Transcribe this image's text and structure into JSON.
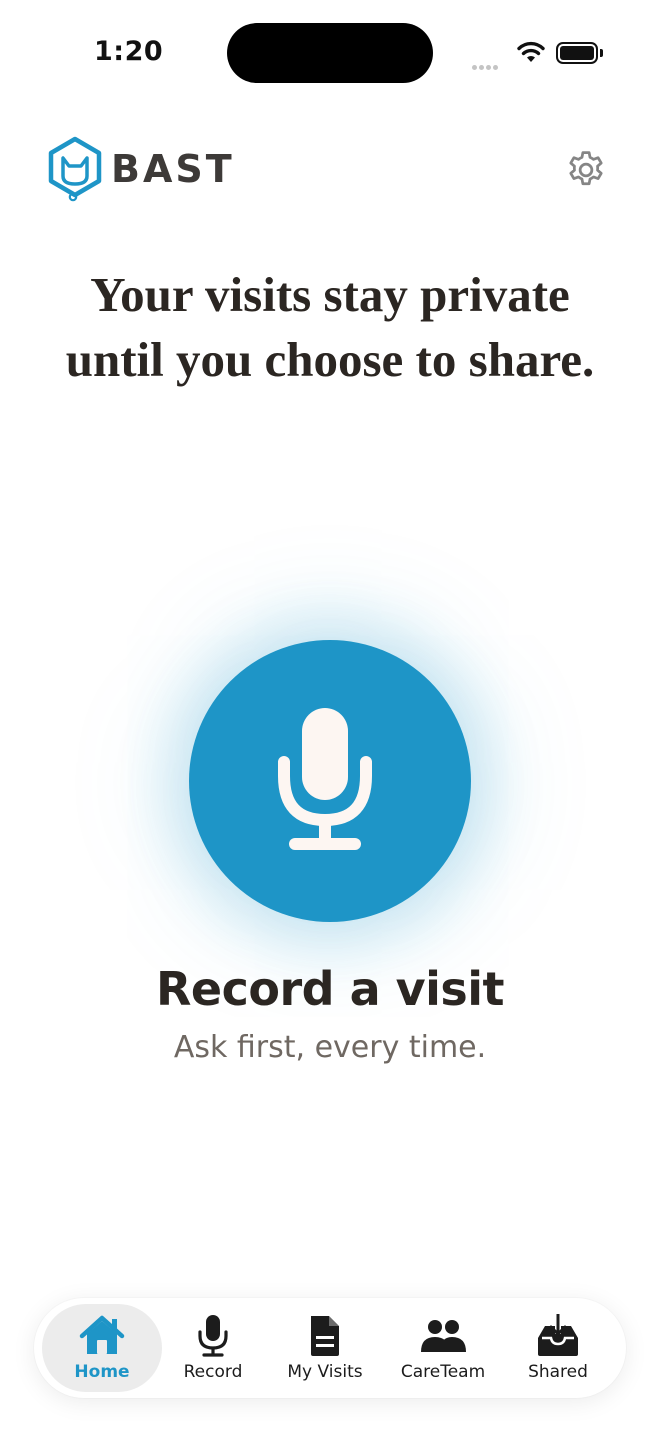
{
  "status_bar": {
    "time": "1:20"
  },
  "header": {
    "brand": "BAST"
  },
  "headline": "Your visits stay private until you choose to share.",
  "record": {
    "title": "Record a visit",
    "subtitle": "Ask first, every time."
  },
  "tabs": [
    {
      "label": "Home",
      "icon": "home-icon",
      "active": true
    },
    {
      "label": "Record",
      "icon": "microphone-icon",
      "active": false
    },
    {
      "label": "My Visits",
      "icon": "document-icon",
      "active": false
    },
    {
      "label": "CareTeam",
      "icon": "people-icon",
      "active": false
    },
    {
      "label": "Shared",
      "icon": "inbox-download-icon",
      "active": false
    }
  ],
  "colors": {
    "accent": "#1e95c7",
    "text": "#2b2622",
    "muted": "#6f6862",
    "active_tab_bg": "#ececec"
  }
}
